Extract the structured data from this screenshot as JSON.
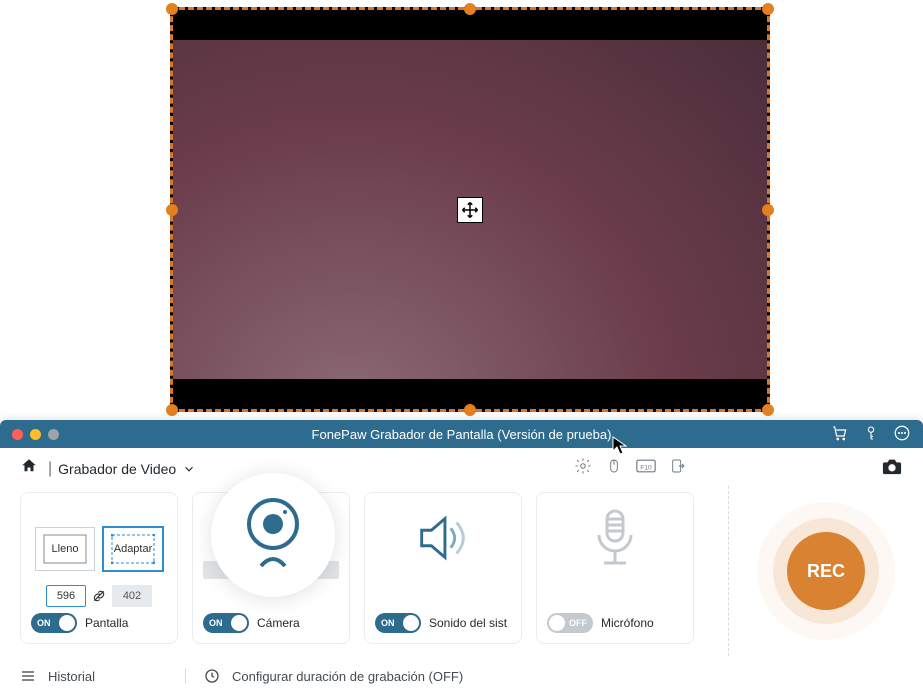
{
  "window": {
    "title": "FonePaw Grabador de Pantalla (Versión de prueba)"
  },
  "breadcrumb": {
    "label": "Grabador de Video"
  },
  "screen_panel": {
    "full_btn": "Lleno",
    "adapt_btn": "Adaptar",
    "width": "596",
    "height": "402",
    "toggle_state": "ON",
    "label": "Pantalla"
  },
  "camera_panel": {
    "toggle_state": "ON",
    "label": "Cámera"
  },
  "sound_panel": {
    "toggle_state": "ON",
    "label": "Sonido del sist"
  },
  "mic_panel": {
    "toggle_state": "OFF",
    "label": "Micrófono"
  },
  "rec_button": "REC",
  "footer": {
    "history": "Historial",
    "duration": "Configurar duración de grabación (OFF)"
  }
}
